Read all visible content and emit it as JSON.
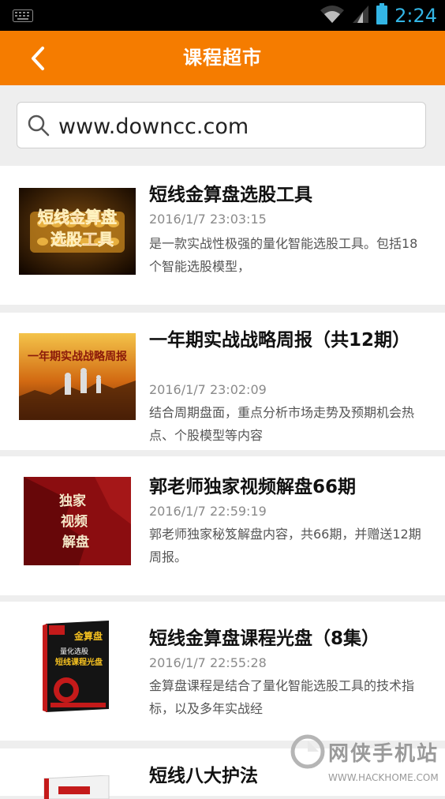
{
  "status_bar": {
    "time": "2:24"
  },
  "header": {
    "title": "课程超市"
  },
  "search": {
    "value": "www.downcc.com"
  },
  "items": [
    {
      "title": "短线金算盘选股工具",
      "date": "2016/1/7 23:03:15",
      "desc": "是一款实战性极强的量化智能选股工具。包括18个智能选股模型，",
      "thumb_text": [
        "短线金算盘",
        "选股工具"
      ]
    },
    {
      "title": "一年期实战战略周报（共12期）",
      "date": "2016/1/7 23:02:09",
      "desc": "结合周期盘面，重点分析市场走势及预期机会热点、个股模型等内容",
      "thumb_text": [
        "一年期实战战略周报"
      ]
    },
    {
      "title": "郭老师独家视频解盘66期",
      "date": "2016/1/7 22:59:19",
      "desc": "郭老师独家秘笈解盘内容，共66期，并赠送12期周报。",
      "thumb_text": [
        "独家",
        "视频",
        "解盘"
      ]
    },
    {
      "title": "短线金算盘课程光盘（8集）",
      "date": "2016/1/7 22:55:28",
      "desc": "金算盘课程是结合了量化智能选股工具的技术指标，以及多年实战经",
      "thumb_text": [
        "金算盘",
        "量化选股",
        "短线课程光盘"
      ]
    },
    {
      "title": "短线八大护法",
      "date": "",
      "desc": "",
      "thumb_text": []
    }
  ],
  "watermark": {
    "cn": "网侠手机站",
    "en": "WWW.HACKHOME.COM"
  },
  "colors": {
    "accent": "#f57c00",
    "status_icon": "#33b5e5"
  }
}
